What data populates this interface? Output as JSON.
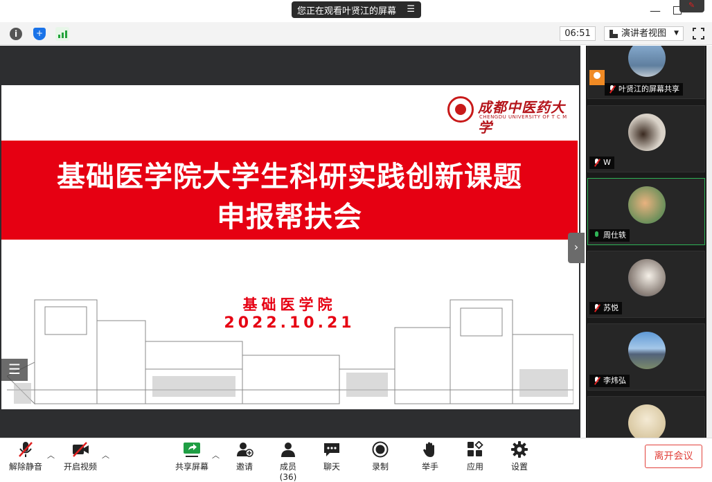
{
  "titlebar": {
    "viewing_text": "您正在观看叶贤江的屏幕",
    "menu_glyph": "☰"
  },
  "infobar": {
    "meeting_time": "06:51",
    "view_mode": "演讲者视图"
  },
  "slide": {
    "logo_cn": "成都中医药大学",
    "logo_en": "CHENGDU UNIVERSITY OF T C M",
    "title_line1": "基础医学院大学生科研实践创新课题",
    "title_line2": "申报帮扶会",
    "college": "基础医学院",
    "date": "2022.10.21"
  },
  "participants": [
    {
      "name": "叶贤江的屏幕共享",
      "mic": "muted",
      "sharing": true
    },
    {
      "name": "W",
      "mic": "muted",
      "sharing": false
    },
    {
      "name": "周仕轶",
      "mic": "on",
      "sharing": false,
      "active_speaker": true
    },
    {
      "name": "苏悦",
      "mic": "muted",
      "sharing": false
    },
    {
      "name": "李炜弘",
      "mic": "muted",
      "sharing": false
    },
    {
      "name": "",
      "mic": "muted",
      "sharing": false
    }
  ],
  "toolbar": {
    "unmute": "解除静音",
    "start_video": "开启视频",
    "share_screen": "共享屏幕",
    "invite": "邀请",
    "members": "成员(36)",
    "chat": "聊天",
    "record": "录制",
    "raise_hand": "举手",
    "apps": "应用",
    "settings": "设置",
    "leave": "离开会议"
  },
  "colors": {
    "banner_red": "#e60012",
    "active_green": "#2fb457",
    "leave_red": "#e1403a",
    "dark_bg": "#1a1a1a"
  }
}
